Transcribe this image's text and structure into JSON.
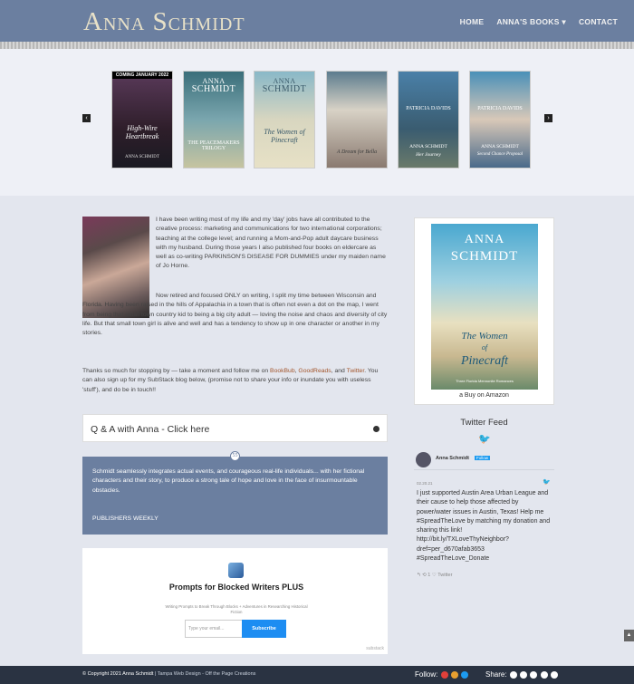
{
  "header": {
    "logo": "Anna Schmidt",
    "nav": [
      "HOME",
      "ANNA'S BOOKS",
      "CONTACT"
    ],
    "books_caret": "▾"
  },
  "carousel": {
    "prev": "‹",
    "next": "›",
    "books": [
      {
        "badge": "COMING JANUARY 2022",
        "author": "",
        "author2": "",
        "title": "High-Wire Heartbreak",
        "author_bottom": "ANNA SCHMIDT"
      },
      {
        "author": "ANNA",
        "author2": "SCHMIDT",
        "title": "THE PEACEMAKERS TRILOGY"
      },
      {
        "author": "ANNA",
        "author2": "SCHMIDT",
        "title": "The Women of Pinecraft"
      },
      {
        "author": "",
        "author2": "",
        "title": "A Dream for Bella"
      },
      {
        "author": "PATRICIA DAVIDS",
        "author2": "ANNA SCHMIDT",
        "title": "Her Journey"
      },
      {
        "author": "PATRICIA DAVIDS",
        "author2": "ANNA SCHMIDT",
        "title": "Second Chance Proposal"
      }
    ]
  },
  "bio": {
    "p1": "I have been writing most of my life and my 'day' jobs have all contributed to the creative process: marketing and communications for two international corporations; teaching at the college level; and running a Mom-and-Pop adult daycare business with my husband. During those years I also published four books on eldercare as well as co-writing PARKINSON'S DISEASE FOR DUMMIES under my maiden name of Jo Horne.",
    "p2": "Now retired and focused ONLY on writing, I split my time between Wisconsin and Florida. Having been raised in the hills of Appalachia in a town that is often not even a dot on the map, I went from being that small town country kid to being a big city adult — loving the noise and chaos and diversity of city life. But that small town girl is alive and well and has a tendency to show up in one character or another in my stories.",
    "p3_a": "Thanks so much for stopping by — take a moment and follow me on ",
    "link_bookbub": "BookBub",
    "p3_b": ", ",
    "link_goodreads": "GoodReads",
    "p3_c": ", and ",
    "link_twitter": "Twitter",
    "p3_d": ". You can also sign up for my SubStack blog below, (promise not to share your info or inundate you with useless 'stuff'), and do be in touch!!"
  },
  "qa": {
    "title": "Q & A with Anna - Click here",
    "toggle": "+"
  },
  "quote": {
    "mark": "55",
    "text": "Schmidt seamlessly integrates actual events, and courageous real-life individuals... with her fictional characters and their story, to produce a strong tale of hope and love in the face of insurmountable obstacles.",
    "source": "PUBLISHERS WEEKLY"
  },
  "substack": {
    "title": "Prompts for Blocked Writers PLUS",
    "subtitle": "Writing Prompts to Break Through Blocks + Adventures in Researching Historical Fiction",
    "input_placeholder": "Type your email...",
    "button": "Subscribe",
    "footer": "substack"
  },
  "sidebar": {
    "cover_author1": "ANNA",
    "cover_author2": "SCHMIDT",
    "cover_title1": "The Women",
    "cover_title_of": "of",
    "cover_title2": "Pinecraft",
    "cover_series": "Three Florida Mennonite Romances",
    "buy": "Buy on Amazon",
    "twitter_title": "Twitter Feed",
    "tweet": {
      "name": "Anna Schmidt",
      "follow": "Follow",
      "date": "02.20.21",
      "text": "I just supported Austin Area Urban League and their cause to help those affected by power/water issues in Austin, Texas! Help me #SpreadTheLove by matching my donation and sharing this link! http://bit.ly/TXLoveThyNeighbor?dref=per_d670afab3653 #SpreadTheLove_Donate",
      "actions": "↰   ⟲ 1   ♡   Twitter"
    }
  },
  "footer": {
    "copy": "© Copyright 2021 Anna Schmidt",
    "credit": " | Tampa Web Design - Off the Page Creations",
    "follow": "Follow:",
    "share": "Share:"
  },
  "colors": {
    "header": "#6b7fa0",
    "footer": "#2a3342",
    "link": "#a3552b",
    "tw_blue": "#1d9bf0"
  }
}
